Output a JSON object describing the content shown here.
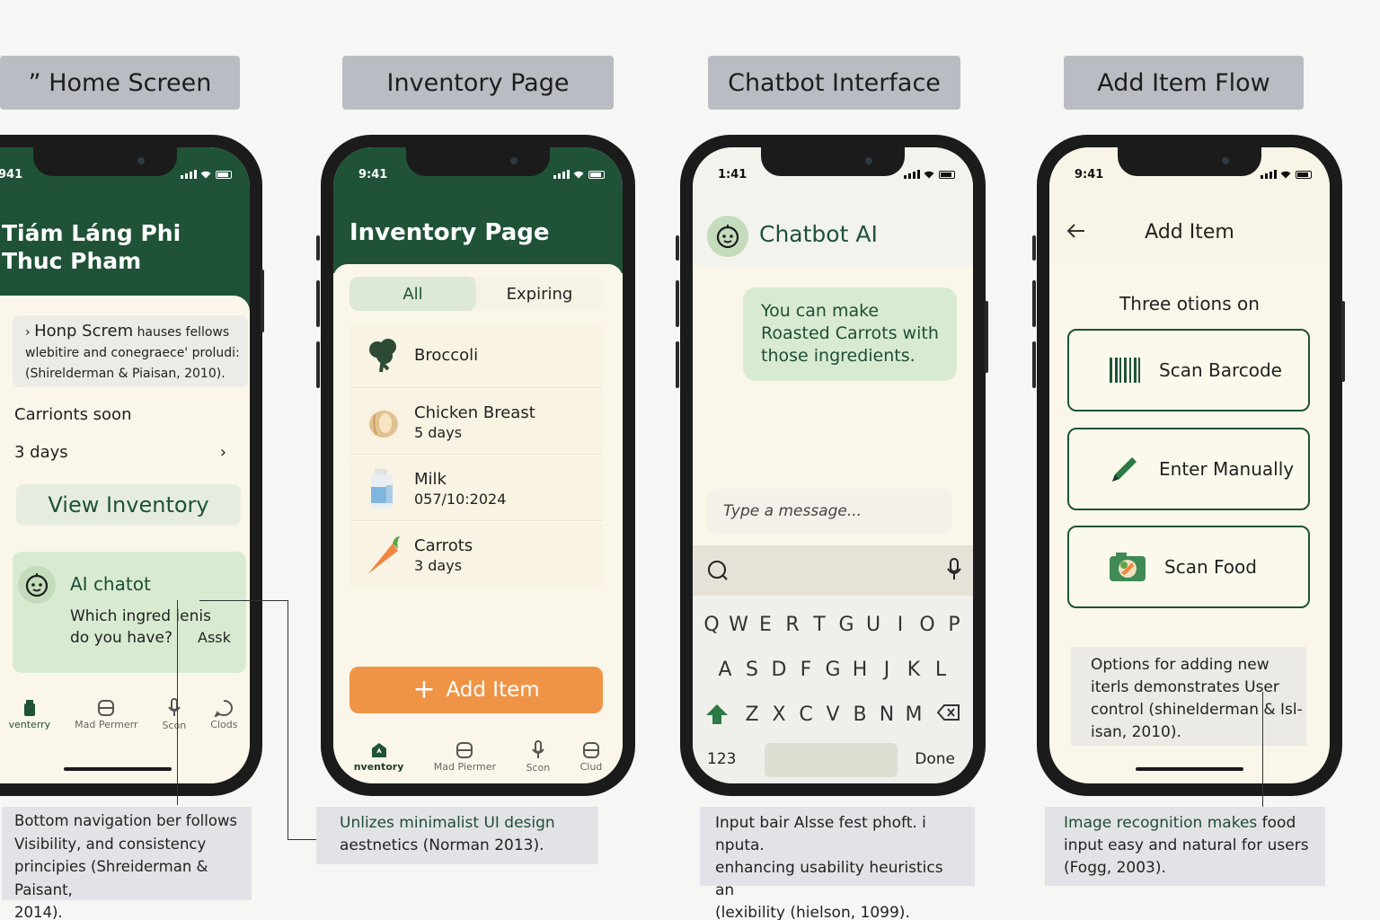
{
  "tabs": [
    "” Home Screen",
    "Inventory Page",
    "Chatbot Interface",
    "Add Item Flow"
  ],
  "home": {
    "time": "941",
    "title1": "Tiám Láng Phi",
    "title2": "Thuc Pham",
    "card_head": "Honp Screm",
    "card_head_tail": "hauses fellows",
    "card_line2": "wlebitire and conegraece' proludi:",
    "card_line3": "(Shirelderman & Piaisan, 2010).",
    "soon": "Carrionts soon",
    "days": "3 days",
    "view_btn": "View Inventory",
    "chat_title": "AI chatot",
    "chat_line1": "Which ingred ienis",
    "chat_line2": "do you have?",
    "ask": "Assk",
    "nav": [
      "venterry",
      "Mad Permerr",
      "Scon",
      "Clods"
    ]
  },
  "inventory": {
    "time": "9:41",
    "title": "Inventory Page",
    "seg_all": "All",
    "seg_exp": "Expiring",
    "items": [
      {
        "name": "Broccoli",
        "sub": ""
      },
      {
        "name": "Chicken Breast",
        "sub": "5 days"
      },
      {
        "name": "Milk",
        "sub": "057/10:2024"
      },
      {
        "name": "Carrots",
        "sub": "3 days"
      }
    ],
    "add_btn": "Add Item",
    "nav": [
      "nventory",
      "Mad Piermer",
      "Scon",
      "Clud"
    ]
  },
  "chatbot": {
    "time": "1:41",
    "title": "Chatbot AI",
    "bubble": "You can make Roasted Carrots with those ingredients.",
    "placeholder": "Type a message...",
    "row1": [
      "Q",
      "W",
      "E",
      "R",
      "T",
      "G",
      "U",
      "I",
      "O",
      "P"
    ],
    "row2": [
      "A",
      "S",
      "D",
      "F",
      "G",
      "H",
      "J",
      "K",
      "L"
    ],
    "row3": [
      "Z",
      "X",
      "C",
      "V",
      "B",
      "N",
      "M"
    ],
    "num_key": "123",
    "done_key": "Done"
  },
  "additem": {
    "time": "9:41",
    "title": "Add Item",
    "subtitle": "Three otions on",
    "options": [
      "Scan Barcode",
      "Enter Manually",
      "Scan Food"
    ],
    "info": [
      "Options for adding new",
      "iterls demonstrates User",
      "control (shinelderman & Isl-",
      "isan, 2010)."
    ]
  },
  "notes": {
    "n1": [
      "Bottom navigation ber follows",
      "Visibility, and consistency",
      "principies (Shreiderman & Paisant,",
      "2014)."
    ],
    "n2_hl": "Unlizes minimalist UI design",
    "n2_rest": "aestnetics (Norman 2013).",
    "n3": [
      "Input bair Alsse fest phoft. i nputa.",
      "enhancing usability heuristics an",
      "(lexibility (hielson, 1099)."
    ],
    "n4_hl": "Image recognition makes",
    "n4_hl_tail": "food",
    "n4_rest": [
      "input easy and natural for users",
      "(Fogg, 2003)."
    ]
  }
}
